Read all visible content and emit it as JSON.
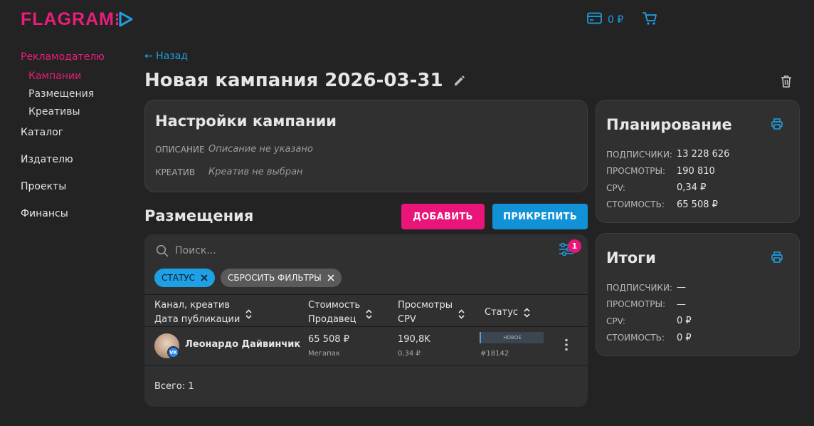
{
  "header": {
    "logo_text": "FLAGRAM",
    "balance": "0 ₽"
  },
  "sidebar": {
    "sections": [
      {
        "label": "Рекламодателю",
        "active": true
      },
      {
        "label": "Каталог"
      },
      {
        "label": "Издателю"
      },
      {
        "label": "Проекты"
      },
      {
        "label": "Финансы"
      }
    ],
    "advertiser_items": [
      {
        "label": "Кампании",
        "active": true
      },
      {
        "label": "Размещения"
      },
      {
        "label": "Креативы"
      }
    ]
  },
  "page": {
    "back_label": "← Назад",
    "title": "Новая кампания 2026-03-31"
  },
  "settings": {
    "title": "Настройки кампании",
    "description_label": "ОПИСАНИЕ",
    "description_value": "Описание не указано",
    "creative_label": "КРЕАТИВ",
    "creative_value": "Креатив не выбран"
  },
  "planning": {
    "title": "Планирование",
    "rows": [
      {
        "label": "ПОДПИСЧИКИ:",
        "value": "13 228 626"
      },
      {
        "label": "ПРОСМОТРЫ:",
        "value": "190 810"
      },
      {
        "label": "CPV:",
        "value": "0,34 ₽"
      },
      {
        "label": "СТОИМОСТЬ:",
        "value": "65 508 ₽"
      }
    ]
  },
  "totals": {
    "title": "Итоги",
    "rows": [
      {
        "label": "ПОДПИСЧИКИ:",
        "value": "—"
      },
      {
        "label": "ПРОСМОТРЫ:",
        "value": "—"
      },
      {
        "label": "CPV:",
        "value": "0 ₽"
      },
      {
        "label": "СТОИМОСТЬ:",
        "value": "0 ₽"
      }
    ]
  },
  "placements": {
    "title": "Размещения",
    "add_label": "ДОБАВИТЬ",
    "attach_label": "ПРИКРЕПИТЬ",
    "search_placeholder": "Поиск...",
    "filter_count": "1",
    "chips": {
      "status": "СТАТУС",
      "reset": "СБРОСИТЬ ФИЛЬТРЫ"
    },
    "columns": {
      "channel_line1": "Канал, креатив",
      "channel_line2": "Дата публикации",
      "cost_line1": "Стоимость",
      "cost_line2": "Продавец",
      "views_line1": "Просмотры",
      "views_line2": "CPV",
      "status": "Статус"
    },
    "rows": [
      {
        "channel": "Леонардо Дайвинчик",
        "network_badge": "VK",
        "cost": "65 508 ₽",
        "seller": "Мегапак",
        "views": "190,8K",
        "cpv": "0,34 ₽",
        "status": "НОВОЕ",
        "order_id": "#18142"
      }
    ],
    "total_label": "Всего: 1"
  },
  "colors": {
    "accent_pink": "#e91e7a",
    "accent_blue": "#1ea0e6",
    "background": "#232323",
    "card": "#303030"
  }
}
